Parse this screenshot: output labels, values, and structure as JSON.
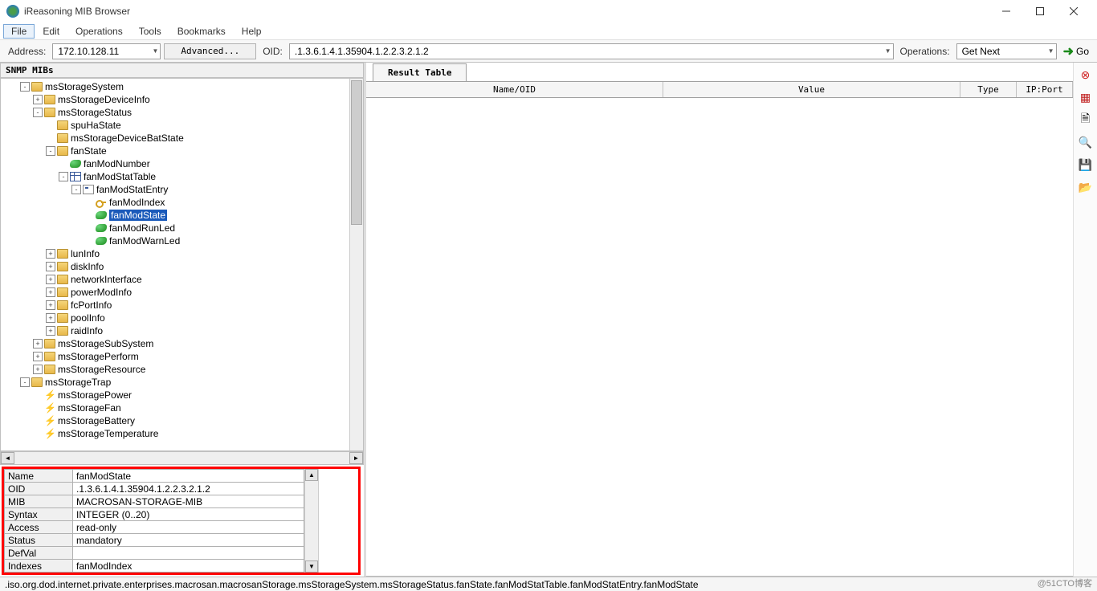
{
  "app_title": "iReasoning MIB Browser",
  "menu": [
    "File",
    "Edit",
    "Operations",
    "Tools",
    "Bookmarks",
    "Help"
  ],
  "menu_active": "File",
  "toolbar": {
    "address_label": "Address:",
    "address_value": "172.10.128.11",
    "advanced_btn": "Advanced...",
    "oid_label": "OID:",
    "oid_value": ".1.3.6.1.4.1.35904.1.2.2.3.2.1.2",
    "ops_label": "Operations:",
    "ops_value": "Get Next",
    "go_label": "Go"
  },
  "mibs_header": "SNMP MIBs",
  "tree": [
    {
      "d": 1,
      "t": "folder",
      "e": "-",
      "l": "msStorageSystem"
    },
    {
      "d": 2,
      "t": "folder",
      "e": "+",
      "l": "msStorageDeviceInfo"
    },
    {
      "d": 2,
      "t": "folder",
      "e": "-",
      "l": "msStorageStatus"
    },
    {
      "d": 3,
      "t": "folder",
      "e": "",
      "l": "spuHaState"
    },
    {
      "d": 3,
      "t": "folder",
      "e": "",
      "l": "msStorageDeviceBatState"
    },
    {
      "d": 3,
      "t": "folder",
      "e": "-",
      "l": "fanState"
    },
    {
      "d": 4,
      "t": "leaf",
      "e": "",
      "l": "fanModNumber"
    },
    {
      "d": 4,
      "t": "table",
      "e": "-",
      "l": "fanModStatTable"
    },
    {
      "d": 5,
      "t": "entry",
      "e": "-",
      "l": "fanModStatEntry"
    },
    {
      "d": 6,
      "t": "key",
      "e": "",
      "l": "fanModIndex"
    },
    {
      "d": 6,
      "t": "leaf",
      "e": "",
      "l": "fanModState",
      "sel": true
    },
    {
      "d": 6,
      "t": "leaf",
      "e": "",
      "l": "fanModRunLed"
    },
    {
      "d": 6,
      "t": "leaf",
      "e": "",
      "l": "fanModWarnLed"
    },
    {
      "d": 3,
      "t": "folder",
      "e": "+",
      "l": "lunInfo"
    },
    {
      "d": 3,
      "t": "folder",
      "e": "+",
      "l": "diskInfo"
    },
    {
      "d": 3,
      "t": "folder",
      "e": "+",
      "l": "networkInterface"
    },
    {
      "d": 3,
      "t": "folder",
      "e": "+",
      "l": "powerModInfo"
    },
    {
      "d": 3,
      "t": "folder",
      "e": "+",
      "l": "fcPortInfo"
    },
    {
      "d": 3,
      "t": "folder",
      "e": "+",
      "l": "poolInfo"
    },
    {
      "d": 3,
      "t": "folder",
      "e": "+",
      "l": "raidInfo"
    },
    {
      "d": 2,
      "t": "folder",
      "e": "+",
      "l": "msStorageSubSystem"
    },
    {
      "d": 2,
      "t": "folder",
      "e": "+",
      "l": "msStoragePerform"
    },
    {
      "d": 2,
      "t": "folder",
      "e": "+",
      "l": "msStorageResource"
    },
    {
      "d": 1,
      "t": "folder",
      "e": "-",
      "l": "msStorageTrap"
    },
    {
      "d": 2,
      "t": "bolt",
      "e": "",
      "l": "msStoragePower"
    },
    {
      "d": 2,
      "t": "bolt",
      "e": "",
      "l": "msStorageFan"
    },
    {
      "d": 2,
      "t": "bolt",
      "e": "",
      "l": "msStorageBattery"
    },
    {
      "d": 2,
      "t": "bolt",
      "e": "",
      "l": "msStorageTemperature"
    }
  ],
  "detail": [
    {
      "k": "Name",
      "v": "fanModState"
    },
    {
      "k": "OID",
      "v": ".1.3.6.1.4.1.35904.1.2.2.3.2.1.2"
    },
    {
      "k": "MIB",
      "v": "MACROSAN-STORAGE-MIB"
    },
    {
      "k": "Syntax",
      "v": "INTEGER (0..20)"
    },
    {
      "k": "Access",
      "v": "read-only"
    },
    {
      "k": "Status",
      "v": "mandatory"
    },
    {
      "k": "DefVal",
      "v": ""
    },
    {
      "k": "Indexes",
      "v": "fanModIndex"
    }
  ],
  "result": {
    "tab": "Result Table",
    "cols": [
      "Name/OID",
      "Value",
      "Type",
      "IP:Port"
    ]
  },
  "status": ".iso.org.dod.internet.private.enterprises.macrosan.macrosanStorage.msStorageSystem.msStorageStatus.fanState.fanModStatTable.fanModStatEntry.fanModState",
  "watermark": "@51CTO博客"
}
